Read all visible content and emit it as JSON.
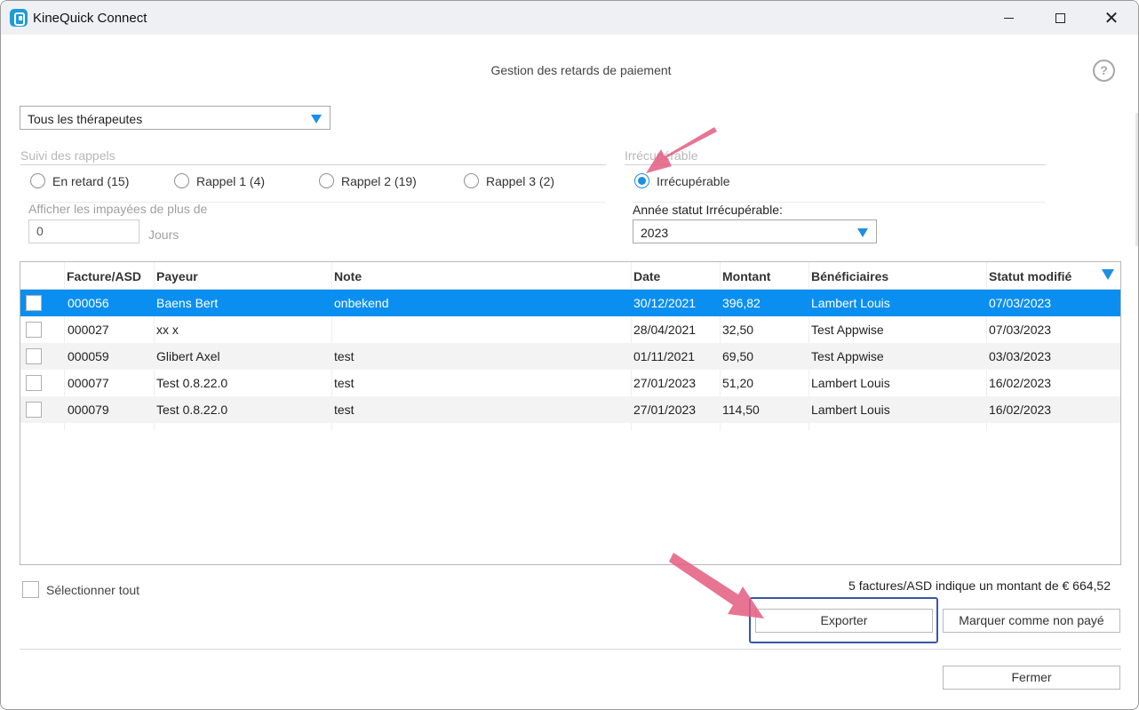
{
  "window": {
    "title": "KineQuick Connect",
    "heading": "Gestion des retards de paiement"
  },
  "filters": {
    "therapist_select": "Tous les thérapeutes",
    "reminder_title": "Suivi des rappels",
    "reminder_options": [
      {
        "label": "En retard (15)",
        "selected": false
      },
      {
        "label": "Rappel 1 (4)",
        "selected": false
      },
      {
        "label": "Rappel 2 (19)",
        "selected": false
      },
      {
        "label": "Rappel 3 (2)",
        "selected": false
      }
    ],
    "unpaid_label": "Afficher les impayées de plus de",
    "days_value": "0",
    "days_unit": "Jours",
    "irrecoverable_title": "Irrécupérable",
    "irrecoverable_option": "Irrécupérable",
    "irrecoverable_selected": true,
    "year_label": "Année statut Irrécupérable:",
    "year_value": "2023"
  },
  "table": {
    "headers": [
      "Facture/ASD",
      "Payeur",
      "Note",
      "Date",
      "Montant",
      "Bénéficiaires",
      "Statut modifié"
    ],
    "rows": [
      {
        "facture": "000056",
        "payeur": "Baens Bert",
        "note": "onbekend",
        "date": "30/12/2021",
        "montant": "396,82",
        "beneficiaire": "Lambert Louis",
        "statut": "07/03/2023",
        "selected": true
      },
      {
        "facture": "000027",
        "payeur": "xx x",
        "note": "",
        "date": "28/04/2021",
        "montant": "32,50",
        "beneficiaire": "Test Appwise",
        "statut": "07/03/2023",
        "selected": false
      },
      {
        "facture": "000059",
        "payeur": "Glibert Axel",
        "note": "test",
        "date": "01/11/2021",
        "montant": "69,50",
        "beneficiaire": "Test Appwise",
        "statut": "03/03/2023",
        "selected": false
      },
      {
        "facture": "000077",
        "payeur": "Test 0.8.22.0",
        "note": "test",
        "date": "27/01/2023",
        "montant": "51,20",
        "beneficiaire": "Lambert Louis",
        "statut": "16/02/2023",
        "selected": false
      },
      {
        "facture": "000079",
        "payeur": "Test 0.8.22.0",
        "note": "test",
        "date": "27/01/2023",
        "montant": "114,50",
        "beneficiaire": "Lambert Louis",
        "statut": "16/02/2023",
        "selected": false
      }
    ]
  },
  "footer": {
    "select_all": "Sélectionner tout",
    "summary": "5 factures/ASD indique un montant de € 664,52",
    "export": "Exporter",
    "mark_unpaid": "Marquer comme non payé",
    "close": "Fermer"
  },
  "colors": {
    "accent": "#0a8ff0",
    "annotation_arrow": "#e45d82",
    "highlight_border": "#3956a6"
  }
}
